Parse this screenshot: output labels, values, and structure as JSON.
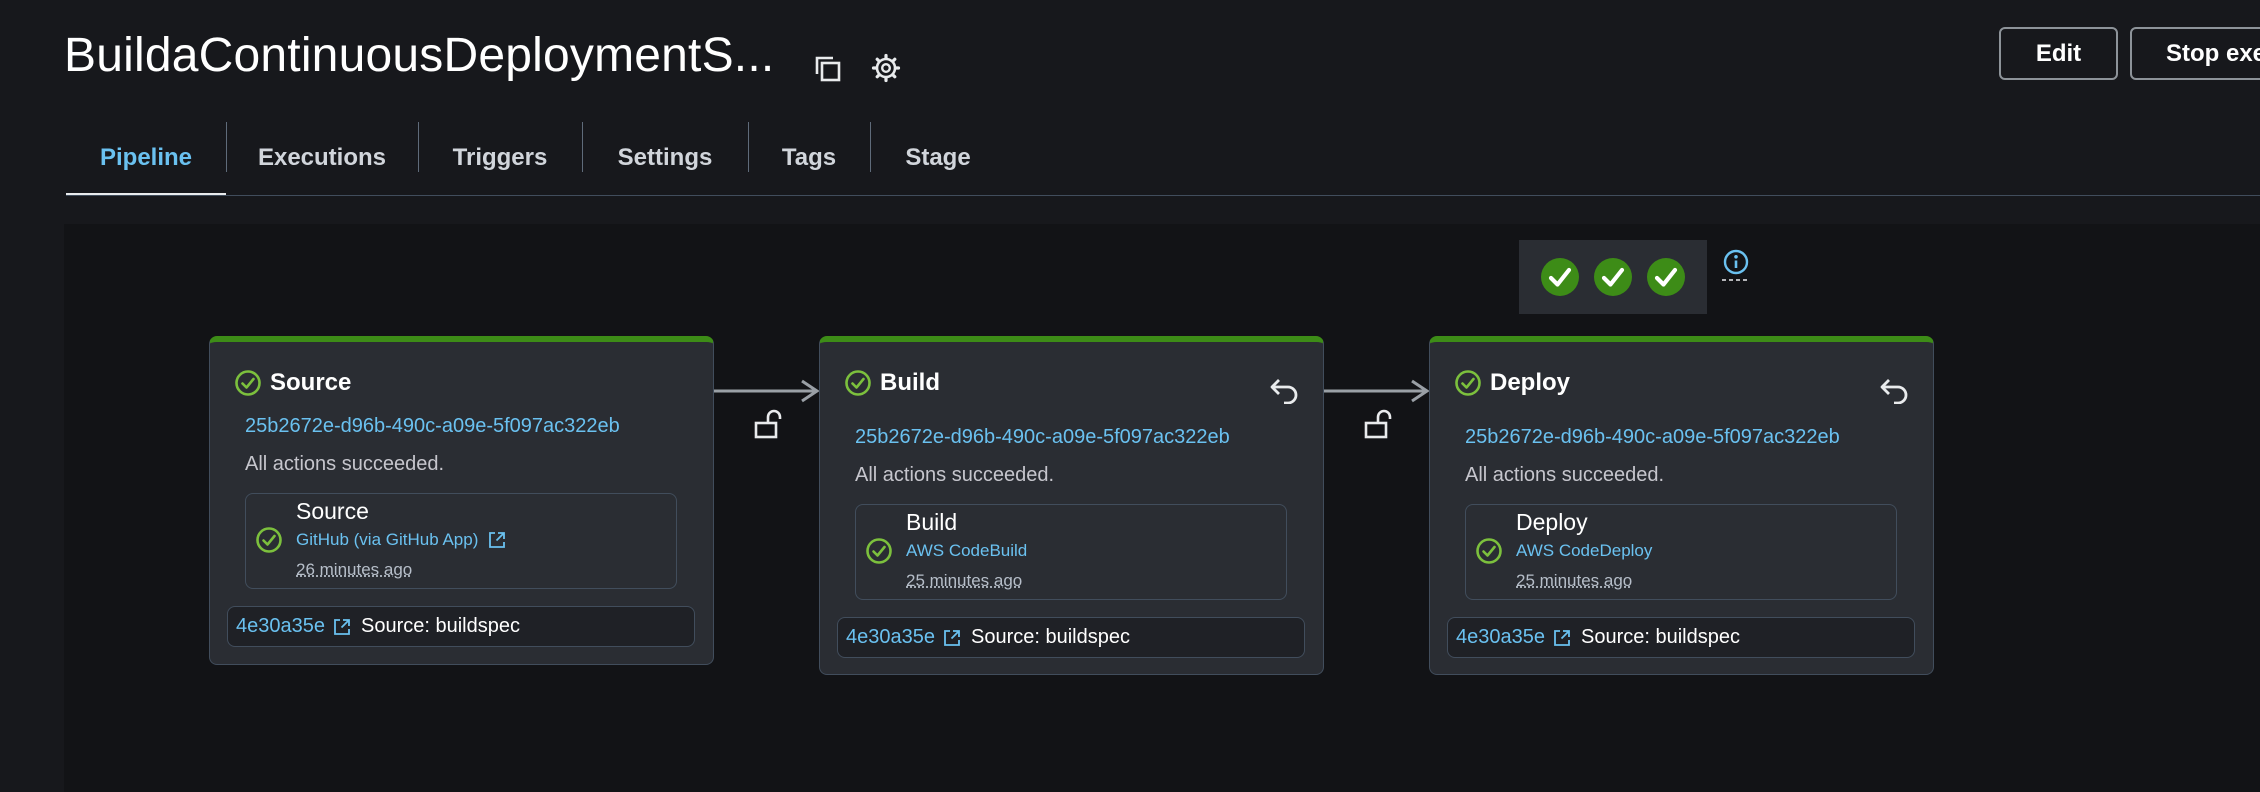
{
  "header": {
    "title": "BuildaContinuousDeploymentS...",
    "copy_icon": "copy-icon",
    "settings_icon": "gear-icon",
    "edit_label": "Edit",
    "stop_label": "Stop execution"
  },
  "tabs": [
    {
      "label": "Pipeline",
      "active": true
    },
    {
      "label": "Executions"
    },
    {
      "label": "Triggers"
    },
    {
      "label": "Settings"
    },
    {
      "label": "Tags"
    },
    {
      "label": "Stage"
    }
  ],
  "colors": {
    "accent": "#6ac1f0",
    "success": "#3d8c17",
    "success_icon": "#7cc03d",
    "background": "#17181c",
    "panel": "#2a2d33"
  },
  "summary": {
    "check_count": 3,
    "info_icon": "info-icon"
  },
  "stages": [
    {
      "name": "Source",
      "execution_id": "25b2672e-d96b-490c-a09e-5f097ac322eb",
      "status": "All actions succeeded.",
      "action": {
        "name": "Source",
        "provider": "GitHub (via GitHub App)",
        "time": "26 minutes ago"
      },
      "artifact": {
        "commit": "4e30a35e",
        "text": "Source: buildspec"
      }
    },
    {
      "name": "Build",
      "execution_id": "25b2672e-d96b-490c-a09e-5f097ac322eb",
      "status": "All actions succeeded.",
      "action": {
        "name": "Build",
        "provider": "AWS CodeBuild",
        "time": "25 minutes ago"
      },
      "artifact": {
        "commit": "4e30a35e",
        "text": "Source: buildspec"
      }
    },
    {
      "name": "Deploy",
      "execution_id": "25b2672e-d96b-490c-a09e-5f097ac322eb",
      "status": "All actions succeeded.",
      "action": {
        "name": "Deploy",
        "provider": "AWS CodeDeploy",
        "time": "25 minutes ago"
      },
      "artifact": {
        "commit": "4e30a35e",
        "text": "Source: buildspec"
      }
    }
  ]
}
